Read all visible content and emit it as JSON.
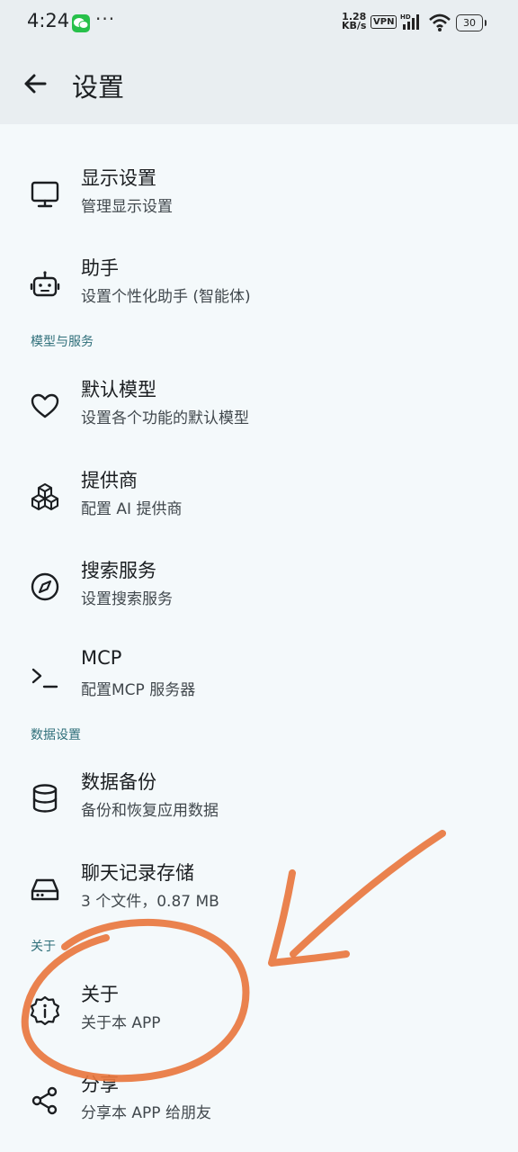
{
  "status_bar": {
    "time": "4:24",
    "more": "···",
    "speed_value": "1.28",
    "speed_unit": "KB/s",
    "vpn": "VPN",
    "battery": "30"
  },
  "app_bar": {
    "title": "设置"
  },
  "items": [
    {
      "title": "显示设置",
      "subtitle": "管理显示设置",
      "icon": "monitor-icon"
    },
    {
      "title": "助手",
      "subtitle": "设置个性化助手 (智能体)",
      "icon": "robot-icon"
    },
    {
      "title": "默认模型",
      "subtitle": "设置各个功能的默认模型",
      "icon": "heart-icon"
    },
    {
      "title": "提供商",
      "subtitle": "配置 AI 提供商",
      "icon": "cubes-icon"
    },
    {
      "title": "搜索服务",
      "subtitle": "设置搜索服务",
      "icon": "compass-icon"
    },
    {
      "title": "MCP",
      "subtitle": "配置MCP 服务器",
      "icon": "terminal-icon"
    },
    {
      "title": "数据备份",
      "subtitle": "备份和恢复应用数据",
      "icon": "database-icon"
    },
    {
      "title": "聊天记录存储",
      "subtitle": "3 个文件，0.87 MB",
      "icon": "hard-drive-icon"
    },
    {
      "title": "关于",
      "subtitle": "关于本 APP",
      "icon": "info-badge-icon"
    },
    {
      "title": "分享",
      "subtitle": "分享本 APP 给朋友",
      "icon": "share-icon"
    }
  ],
  "sections": {
    "models": "模型与服务",
    "data": "数据设置",
    "about": "关于"
  },
  "colors": {
    "background": "#f4f9fb",
    "app_bar": "#e9eef1",
    "section_label": "#2f6f7a",
    "annotation": "#e8773f"
  }
}
